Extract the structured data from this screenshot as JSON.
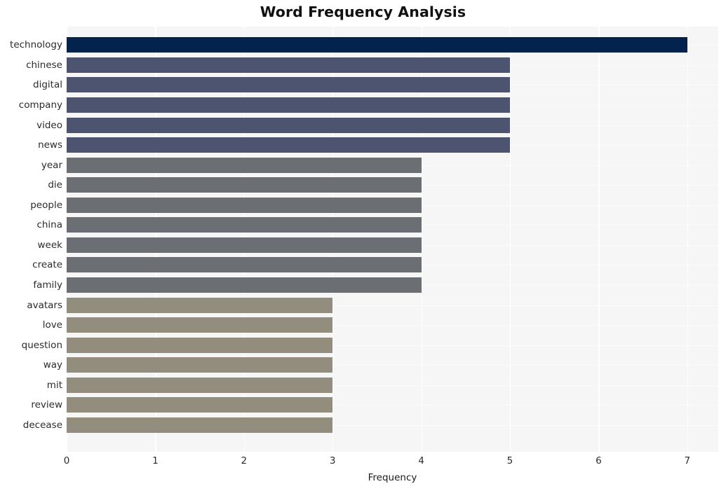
{
  "chart_data": {
    "type": "bar",
    "orientation": "horizontal",
    "title": "Word Frequency Analysis",
    "xlabel": "Frequency",
    "ylabel": "",
    "categories": [
      "technology",
      "chinese",
      "digital",
      "company",
      "video",
      "news",
      "year",
      "die",
      "people",
      "china",
      "week",
      "create",
      "family",
      "avatars",
      "love",
      "question",
      "way",
      "mit",
      "review",
      "decease"
    ],
    "values": [
      7,
      5,
      5,
      5,
      5,
      5,
      4,
      4,
      4,
      4,
      4,
      4,
      4,
      3,
      3,
      3,
      3,
      3,
      3,
      3
    ],
    "bar_colors": [
      "#03224c",
      "#4c5470",
      "#4c5470",
      "#4c5470",
      "#4c5470",
      "#4c5470",
      "#6b6e72",
      "#6b6e72",
      "#6b6e72",
      "#6b6e72",
      "#6b6e72",
      "#6b6e72",
      "#6b6e72",
      "#938d7d",
      "#938d7d",
      "#938d7d",
      "#938d7d",
      "#938d7d",
      "#938d7d",
      "#938d7d"
    ],
    "xticks": [
      "0",
      "1",
      "2",
      "3",
      "4",
      "5",
      "6",
      "7"
    ],
    "xtick_values": [
      0,
      1,
      2,
      3,
      4,
      5,
      6,
      7
    ],
    "xlim": [
      0,
      7.35
    ],
    "grid": true,
    "legend": null,
    "plot_background": "#f6f6f7",
    "figure_background": "#ffffff",
    "gridline_color": "#ffffff",
    "title_color": "#111111",
    "tick_color": "#2b2b2b"
  }
}
